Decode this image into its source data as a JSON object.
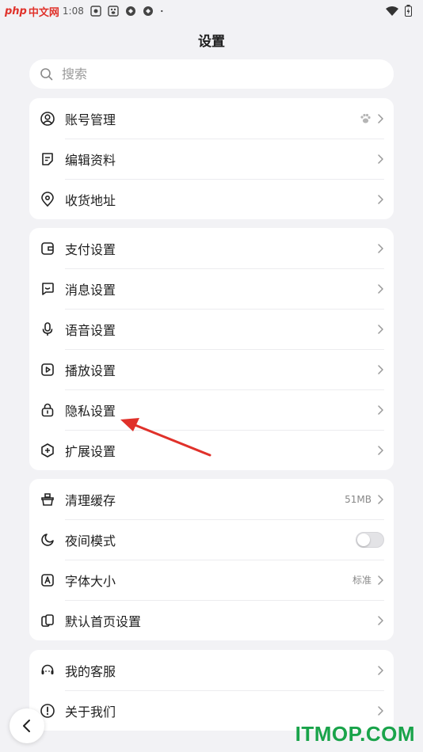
{
  "status_bar": {
    "time": "1:08",
    "watermark_php": "php",
    "watermark_cn": "中文网",
    "icons": [
      "album-icon",
      "baidu-paw-icon",
      "app-icon",
      "app-icon",
      "dot-icon",
      "wifi-icon",
      "battery-icon"
    ]
  },
  "header": {
    "title": "设置"
  },
  "search": {
    "placeholder": "搜索"
  },
  "groups": [
    {
      "items": [
        {
          "label": "账号管理",
          "icon": "user-circle-icon",
          "right": "paw-icon"
        },
        {
          "label": "编辑资料",
          "icon": "edit-note-icon"
        },
        {
          "label": "收货地址",
          "icon": "location-pin-icon"
        }
      ]
    },
    {
      "items": [
        {
          "label": "支付设置",
          "icon": "wallet-icon"
        },
        {
          "label": "消息设置",
          "icon": "chat-bubble-icon"
        },
        {
          "label": "语音设置",
          "icon": "microphone-icon"
        },
        {
          "label": "播放设置",
          "icon": "play-icon"
        },
        {
          "label": "隐私设置",
          "icon": "lock-icon"
        },
        {
          "label": "扩展设置",
          "icon": "plus-hexagon-icon"
        }
      ]
    },
    {
      "items": [
        {
          "label": "清理缓存",
          "icon": "broom-icon",
          "value": "51MB"
        },
        {
          "label": "夜间模式",
          "icon": "moon-icon",
          "toggle": false
        },
        {
          "label": "字体大小",
          "icon": "font-a-icon",
          "value": "标准"
        },
        {
          "label": "默认首页设置",
          "icon": "home-pages-icon"
        }
      ]
    },
    {
      "items": [
        {
          "label": "我的客服",
          "icon": "headset-icon"
        },
        {
          "label": "关于我们",
          "icon": "info-icon"
        }
      ]
    }
  ],
  "watermark": "ITMOP.COM",
  "colors": {
    "annotation_arrow": "#e0312a",
    "watermark": "#19a34a",
    "background": "#f2f2f5"
  }
}
